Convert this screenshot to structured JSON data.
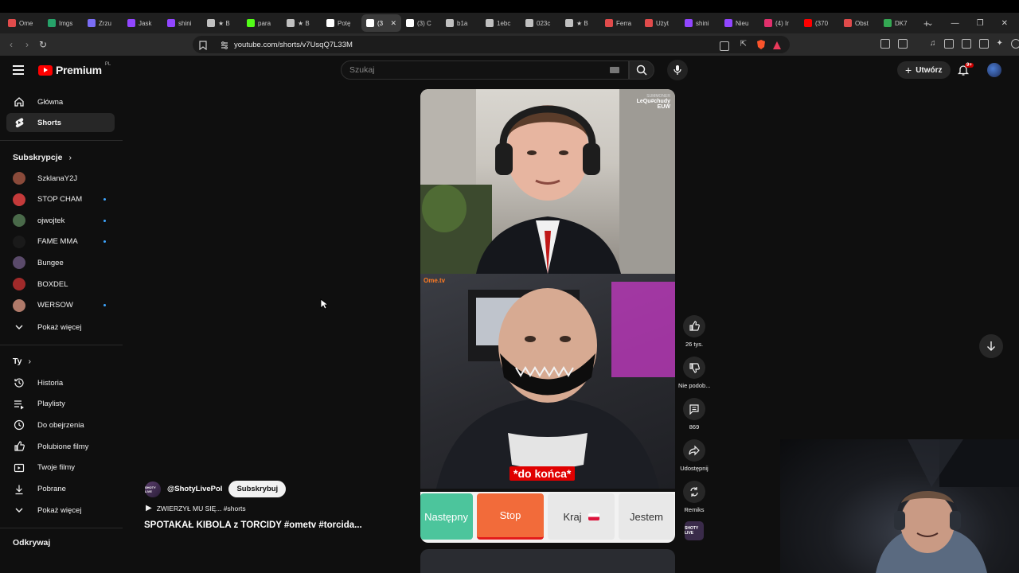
{
  "browser": {
    "tabs": [
      {
        "label": "Ome",
        "color": "#e04b4b"
      },
      {
        "label": "Imgs",
        "color": "#26a269"
      },
      {
        "label": "Zrzu",
        "color": "#7a6df5"
      },
      {
        "label": "Jask",
        "color": "#9146ff"
      },
      {
        "label": "shini",
        "color": "#9146ff"
      },
      {
        "label": "★ B",
        "color": "#c0c0c0"
      },
      {
        "label": "para",
        "color": "#53fc18"
      },
      {
        "label": "★ B",
        "color": "#c0c0c0"
      },
      {
        "label": "Potę",
        "color": "#ffffff"
      },
      {
        "label": "(3",
        "color": "#ffffff",
        "active": true
      },
      {
        "label": "(3) C",
        "color": "#ffffff"
      },
      {
        "label": "b1a",
        "color": "#c0c0c0"
      },
      {
        "label": "1ebc",
        "color": "#c0c0c0"
      },
      {
        "label": "023c",
        "color": "#c0c0c0"
      },
      {
        "label": "★ B",
        "color": "#c0c0c0"
      },
      {
        "label": "Ferra",
        "color": "#e04b4b"
      },
      {
        "label": "Użyt",
        "color": "#e04b4b"
      },
      {
        "label": "shini",
        "color": "#9146ff"
      },
      {
        "label": "Nieu",
        "color": "#9146ff"
      },
      {
        "label": "(4) Ir",
        "color": "#e1306c"
      },
      {
        "label": "(370",
        "color": "#ff0000"
      },
      {
        "label": "Obst",
        "color": "#e04b4b"
      },
      {
        "label": "DK7",
        "color": "#34a853"
      }
    ],
    "url": "youtube.com/shorts/v7UsqQ7L33M"
  },
  "header": {
    "logo_text": "Premium",
    "logo_country": "PL",
    "search_placeholder": "Szukaj",
    "create_label": "Utwórz",
    "notif_count": "9+"
  },
  "sidebar": {
    "main": [
      {
        "label": "Główna",
        "icon": "home-icon"
      },
      {
        "label": "Shorts",
        "icon": "shorts-icon",
        "active": true
      }
    ],
    "subs_title": "Subskrypcje",
    "subs": [
      {
        "label": "SzklanaY2J",
        "color": "#8a4a3a",
        "dot": false
      },
      {
        "label": "STOP CHAM",
        "color": "#c43a3a",
        "dot": true
      },
      {
        "label": "ojwojtek",
        "color": "#4a6a4a",
        "dot": true
      },
      {
        "label": "FAME MMA",
        "color": "#1a1a1a",
        "dot": true
      },
      {
        "label": "Bungee",
        "color": "#5a4a6a",
        "dot": false
      },
      {
        "label": "BOXDEL",
        "color": "#a02a2a",
        "dot": false
      },
      {
        "label": "WERSOW",
        "color": "#b07a6a",
        "dot": true
      }
    ],
    "subs_more": "Pokaż więcej",
    "you_title": "Ty",
    "you": [
      {
        "label": "Historia",
        "icon": "history-icon"
      },
      {
        "label": "Playlisty",
        "icon": "playlists-icon"
      },
      {
        "label": "Do obejrzenia",
        "icon": "watch-later-icon"
      },
      {
        "label": "Polubione filmy",
        "icon": "liked-icon"
      },
      {
        "label": "Twoje filmy",
        "icon": "your-videos-icon"
      },
      {
        "label": "Pobrane",
        "icon": "downloads-icon"
      }
    ],
    "you_more": "Pokaż więcej",
    "explore_title": "Odkrywaj"
  },
  "video": {
    "summoner_label": "SUMMONER",
    "summoner_name": "LeQu#chudy",
    "region": "EUW",
    "ometv": "Ome.tv",
    "caption": "*do końca*",
    "buttons": {
      "next": "Następny",
      "stop": "Stop",
      "country": "Kraj",
      "am": "Jestem"
    }
  },
  "actions": {
    "likes": "26 tys.",
    "dislike": "Nie podob...",
    "comments": "869",
    "share": "Udostępnij",
    "remix": "Remiks"
  },
  "channel": {
    "handle": "@ShotyLivePol",
    "avatar_text": "SHOTY LIVE",
    "subscribe": "Subskrybuj",
    "playlist": "ZWIERZYŁ MU SIĘ... #shorts",
    "title": "SPOTAKAŁ KIBOLA z TORCIDY #ometv #torcida..."
  }
}
